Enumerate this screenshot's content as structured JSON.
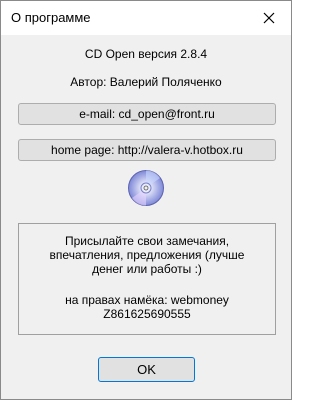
{
  "window": {
    "title": "О программе"
  },
  "about": {
    "version_line": "CD Open версия    2.8.4",
    "author_line": "Автор: Валерий Поляченко",
    "email_button": "e-mail: cd_open@front.ru",
    "homepage_button": "home page: http://valera-v.hotbox.ru",
    "disc_icon": "cd-disc-icon"
  },
  "message": {
    "line1": "Присылайте свои замечания,",
    "line2": "впечатления,  предложения (лучше",
    "line3": "денег или работы :)",
    "line4": "на правах намёка: webmoney",
    "line5": "Z861625690555"
  },
  "buttons": {
    "ok": "OK"
  }
}
